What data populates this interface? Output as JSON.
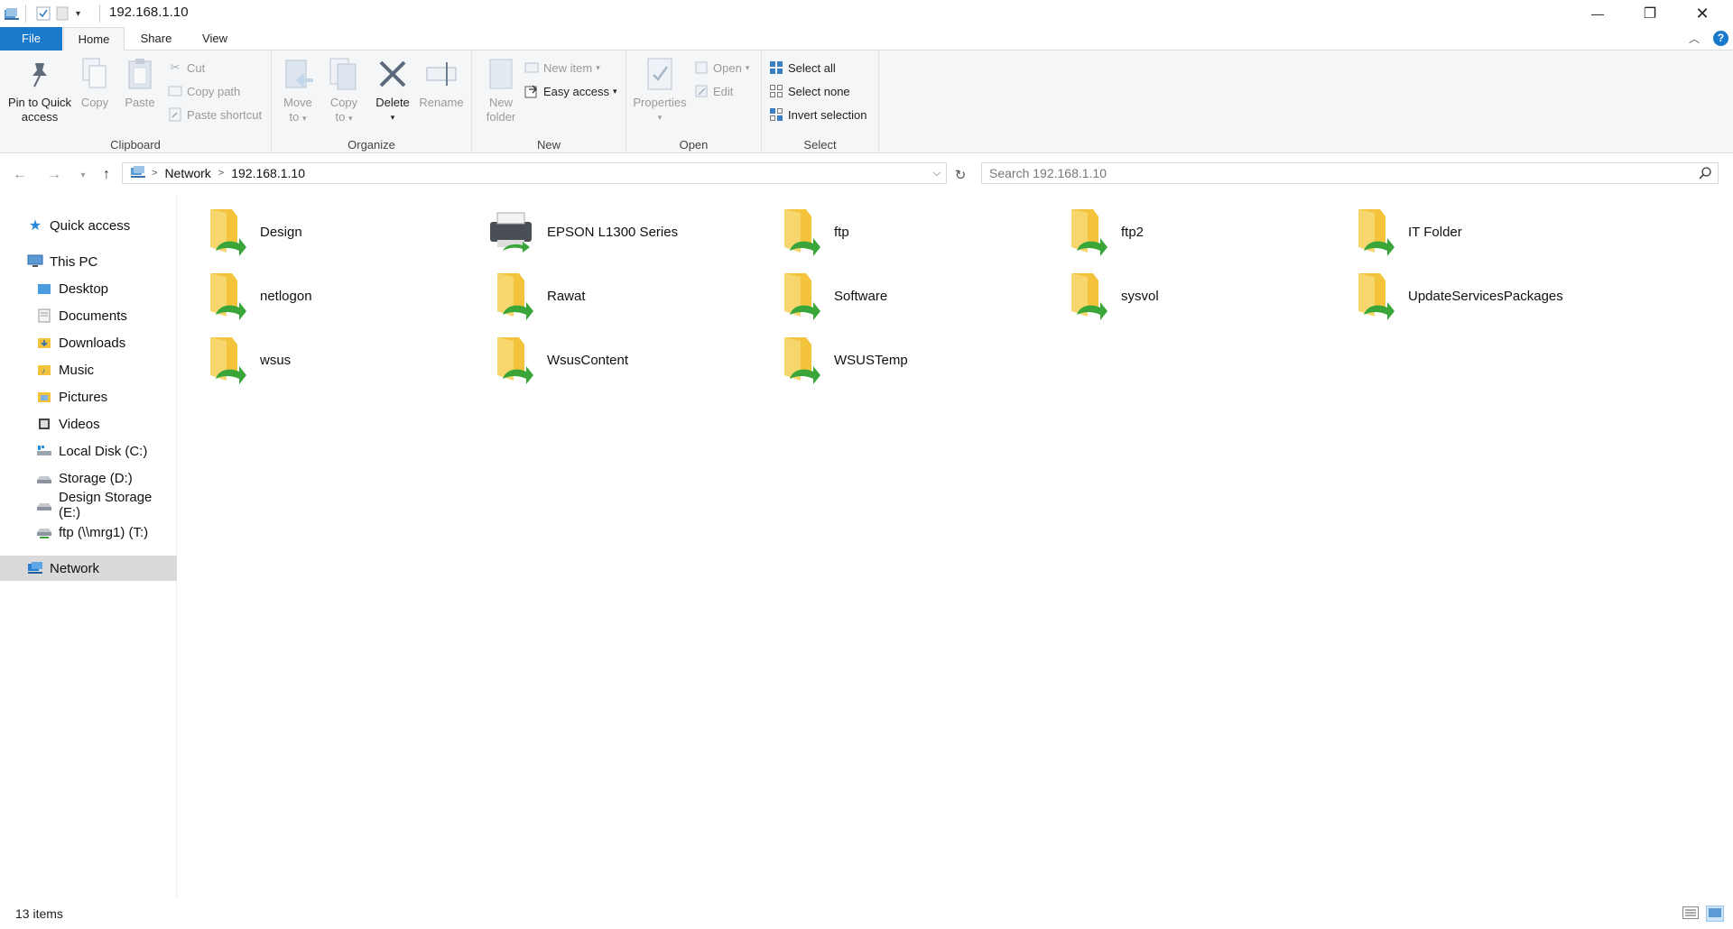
{
  "window": {
    "title": "192.168.1.10",
    "controls": {
      "minimize": "—",
      "maximize": "❐",
      "close": "✕"
    }
  },
  "ribbon_tabs": [
    {
      "label": "File"
    },
    {
      "label": "Home"
    },
    {
      "label": "Share"
    },
    {
      "label": "View"
    }
  ],
  "ribbon": {
    "clipboard": {
      "label": "Clipboard",
      "pin": "Pin to Quick access",
      "pin_line1": "Pin to Quick",
      "pin_line2": "access",
      "copy": "Copy",
      "paste": "Paste",
      "cut": "Cut",
      "copy_path": "Copy path",
      "paste_shortcut": "Paste shortcut"
    },
    "organize": {
      "label": "Organize",
      "move_to_line1": "Move",
      "move_to_line2": "to",
      "copy_to_line1": "Copy",
      "copy_to_line2": "to",
      "delete": "Delete",
      "rename": "Rename"
    },
    "new": {
      "label": "New",
      "new_folder_line1": "New",
      "new_folder_line2": "folder",
      "new_item": "New item",
      "easy_access": "Easy access"
    },
    "open": {
      "label": "Open",
      "properties": "Properties",
      "open": "Open",
      "edit": "Edit"
    },
    "select": {
      "label": "Select",
      "select_all": "Select all",
      "select_none": "Select none",
      "invert_selection": "Invert selection"
    }
  },
  "address": {
    "crumbs": [
      "Network",
      "192.168.1.10"
    ],
    "search_placeholder": "Search 192.168.1.10"
  },
  "navpane": {
    "quick_access": "Quick access",
    "this_pc": "This PC",
    "pc_items": [
      {
        "label": "Desktop",
        "icon": "desktop-folder-icon"
      },
      {
        "label": "Documents",
        "icon": "documents-folder-icon"
      },
      {
        "label": "Downloads",
        "icon": "downloads-folder-icon"
      },
      {
        "label": "Music",
        "icon": "music-folder-icon"
      },
      {
        "label": "Pictures",
        "icon": "pictures-folder-icon"
      },
      {
        "label": "Videos",
        "icon": "videos-folder-icon"
      },
      {
        "label": "Local Disk (C:)",
        "icon": "system-drive-icon"
      },
      {
        "label": "Storage (D:)",
        "icon": "drive-icon"
      },
      {
        "label": "Design Storage (E:)",
        "icon": "drive-icon"
      },
      {
        "label": "ftp (\\\\mrg1) (T:)",
        "icon": "network-drive-icon"
      }
    ],
    "network": "Network"
  },
  "items": [
    {
      "name": "Design",
      "type": "share"
    },
    {
      "name": "EPSON L1300 Series",
      "type": "printer"
    },
    {
      "name": "ftp",
      "type": "share"
    },
    {
      "name": "ftp2",
      "type": "share"
    },
    {
      "name": "IT Folder",
      "type": "share"
    },
    {
      "name": "netlogon",
      "type": "share"
    },
    {
      "name": "Rawat",
      "type": "share"
    },
    {
      "name": "Software",
      "type": "share"
    },
    {
      "name": "sysvol",
      "type": "share"
    },
    {
      "name": "UpdateServicesPackages",
      "type": "share"
    },
    {
      "name": "wsus",
      "type": "share"
    },
    {
      "name": "WsusContent",
      "type": "share"
    },
    {
      "name": "WSUSTemp",
      "type": "share"
    }
  ],
  "status": {
    "count": "13 items"
  },
  "colors": {
    "accent": "#1979ca",
    "folder": "#f3c33c",
    "share_green": "#3aa63a",
    "selection": "#d9d9d9"
  }
}
